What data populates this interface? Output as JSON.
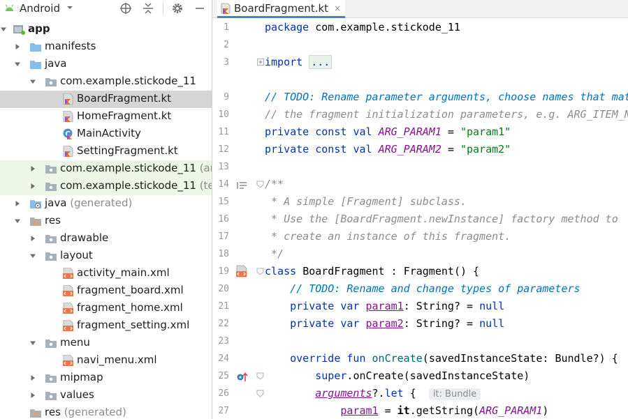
{
  "project_panel": {
    "title": "Android",
    "tree": [
      {
        "label": "app",
        "hint": "",
        "icon": "app-module-icon"
      },
      {
        "label": "manifests",
        "hint": "",
        "icon": "folder-icon"
      },
      {
        "label": "java",
        "hint": "",
        "icon": "folder-icon"
      },
      {
        "label": "com.example.stickode_11",
        "hint": "",
        "icon": "package-icon"
      },
      {
        "label": "BoardFragment.kt",
        "hint": "",
        "icon": "kotlin-file-icon"
      },
      {
        "label": "HomeFragment.kt",
        "hint": "",
        "icon": "kotlin-file-icon"
      },
      {
        "label": "MainActivity",
        "hint": "",
        "icon": "kotlin-class-icon"
      },
      {
        "label": "SettingFragment.kt",
        "hint": "",
        "icon": "kotlin-file-icon"
      },
      {
        "label": "com.example.stickode_11",
        "hint": " (andro",
        "icon": "package-icon"
      },
      {
        "label": "com.example.stickode_11",
        "hint": " (test)",
        "icon": "package-icon"
      },
      {
        "label": "java",
        "hint": " (generated)",
        "icon": "generated-folder-icon"
      },
      {
        "label": "res",
        "hint": "",
        "icon": "res-folder-icon"
      },
      {
        "label": "drawable",
        "hint": "",
        "icon": "package-icon"
      },
      {
        "label": "layout",
        "hint": "",
        "icon": "package-icon"
      },
      {
        "label": "activity_main.xml",
        "hint": "",
        "icon": "xml-layout-icon"
      },
      {
        "label": "fragment_board.xml",
        "hint": "",
        "icon": "xml-layout-icon"
      },
      {
        "label": "fragment_home.xml",
        "hint": "",
        "icon": "xml-layout-icon"
      },
      {
        "label": "fragment_setting.xml",
        "hint": "",
        "icon": "xml-layout-icon"
      },
      {
        "label": "menu",
        "hint": "",
        "icon": "package-icon"
      },
      {
        "label": "navi_menu.xml",
        "hint": "",
        "icon": "xml-layout-icon"
      },
      {
        "label": "mipmap",
        "hint": "",
        "icon": "package-icon"
      },
      {
        "label": "values",
        "hint": "",
        "icon": "package-icon"
      },
      {
        "label": "res",
        "hint": " (generated)",
        "icon": "res-folder-icon"
      }
    ]
  },
  "editor": {
    "tab_label": "BoardFragment.kt",
    "tab_close": "×",
    "line_numbers": [
      "1",
      "2",
      "3",
      "9",
      "10",
      "11",
      "12",
      "13",
      "14",
      "15",
      "16",
      "17",
      "18",
      "19",
      "20",
      "21",
      "22",
      "23",
      "24",
      "25",
      "26",
      "27"
    ],
    "lines": [
      "package com.example.stickode_11",
      "",
      "import ...",
      "// TODO: Rename parameter arguments, choose names that mat",
      "// the fragment initialization parameters, e.g. ARG_ITEM_N",
      "private const val ARG_PARAM1 = \"param1\"",
      "private const val ARG_PARAM2 = \"param2\"",
      "",
      "/**",
      " * A simple [Fragment] subclass.",
      " * Use the [BoardFragment.newInstance] factory method to",
      " * create an instance of this fragment.",
      " */",
      "class BoardFragment : Fragment() {",
      "    // TODO: Rename and change types of parameters",
      "    private var param1: String? = null",
      "    private var param2: String? = null",
      "",
      "    override fun onCreate(savedInstanceState: Bundle?) {",
      "        super.onCreate(savedInstanceState)",
      "        arguments?.let {  it: Bundle",
      "            param1 = it.getString(ARG_PARAM1)"
    ]
  },
  "colors": {
    "keyword": "#0033b3",
    "string": "#067d17",
    "comment": "#8c8c8c",
    "todo": "#0073bf",
    "constant": "#871094",
    "selection": "#d5d5d5",
    "test_package_bg": "#eef6e7"
  }
}
